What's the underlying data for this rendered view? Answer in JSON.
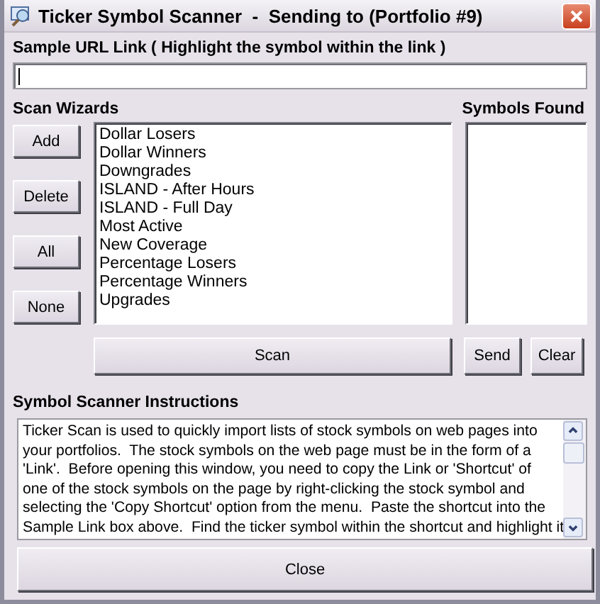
{
  "window": {
    "title": "Ticker Symbol Scanner  -  Sending to (Portfolio #9)"
  },
  "url_field": {
    "label": "Sample URL Link ( Highlight the symbol within the link )"
  },
  "scan_wizards": {
    "label": "Scan Wizards",
    "buttons": [
      "Add",
      "Delete",
      "All",
      "None"
    ],
    "items": [
      "Dollar Losers",
      "Dollar Winners",
      "Downgrades",
      "ISLAND - After Hours",
      "ISLAND - Full Day",
      "Most Active",
      "New Coverage",
      "Percentage Losers",
      "Percentage Winners",
      "Upgrades"
    ],
    "scan_button": "Scan"
  },
  "symbols_found": {
    "label": "Symbols Found",
    "buttons": [
      "Send",
      "Clear"
    ]
  },
  "instructions": {
    "label": "Symbol Scanner Instructions",
    "text": "Ticker Scan is used to quickly import lists of stock symbols on web pages into\nyour portfolios.  The stock symbols on the web page must be in the form of a\n'Link'.  Before opening this window, you need to copy the Link or 'Shortcut' of\none of the stock symbols on the page by right-clicking the stock symbol and\nselecting the 'Copy Shortcut' option from the menu.  Paste the shortcut into the\nSample Link box above.  Find the ticker symbol within the shortcut and highlight it"
  },
  "close_button": "Close"
}
